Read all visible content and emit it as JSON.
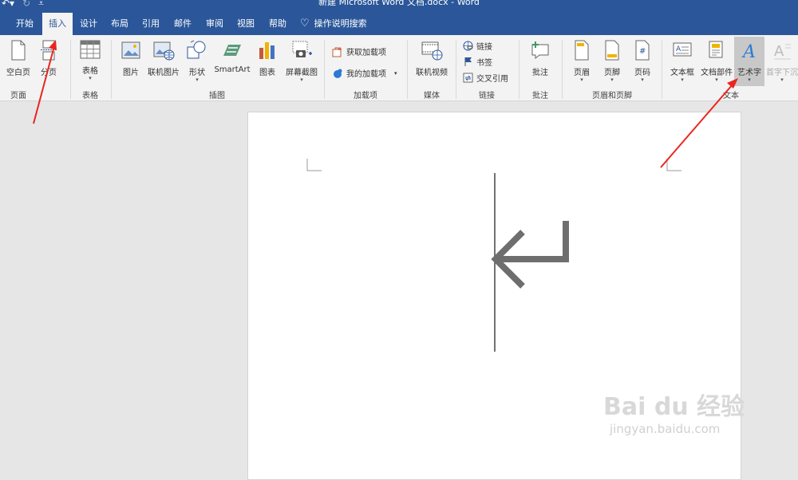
{
  "window": {
    "title": "新建 Microsoft Word 文档.docx  -  Word"
  },
  "tabs": [
    "开始",
    "插入",
    "设计",
    "布局",
    "引用",
    "邮件",
    "审阅",
    "视图",
    "帮助"
  ],
  "tell_me": "操作说明搜索",
  "ribbon": {
    "pages": {
      "blank": "空白页",
      "break": "分页",
      "group": "页面"
    },
    "tables": {
      "table": "表格",
      "group": "表格"
    },
    "illustrations": {
      "picture": "图片",
      "online_picture": "联机图片",
      "shapes": "形状",
      "smartart": "SmartArt",
      "chart": "图表",
      "screenshot": "屏幕截图",
      "group": "插图"
    },
    "addins": {
      "get": "获取加载项",
      "my": "我的加载项",
      "group": "加载项"
    },
    "media": {
      "online_video": "联机视频",
      "group": "媒体"
    },
    "links": {
      "link": "链接",
      "bookmark": "书签",
      "cross_ref": "交叉引用",
      "group": "链接"
    },
    "comments": {
      "comment": "批注",
      "group": "批注"
    },
    "header_footer": {
      "header": "页眉",
      "footer": "页脚",
      "page_number": "页码",
      "group": "页眉和页脚"
    },
    "text": {
      "textbox": "文本框",
      "quick_parts": "文档部件",
      "wordart": "艺术字",
      "dropcap": "首字下沉",
      "group": "文本"
    }
  },
  "watermark": {
    "brand": "Bai du 经验",
    "url": "jingyan.baidu.com"
  },
  "colors": {
    "word_blue": "#2b579a",
    "annotation_red": "#e8261e",
    "wordart_highlight": "#c8c8c8"
  }
}
